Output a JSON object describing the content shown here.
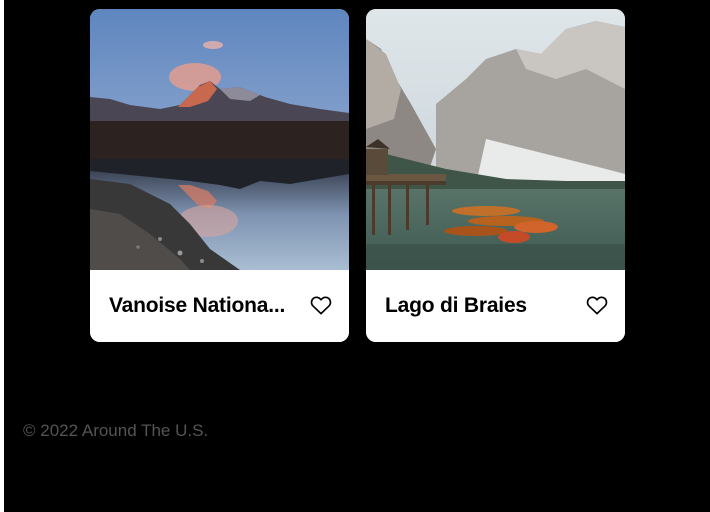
{
  "cards": [
    {
      "title": "Vanoise Nationa...",
      "like_icon": "heart-outline-icon",
      "image": "mountain-lake-dusk"
    },
    {
      "title": "Lago di Braies",
      "like_icon": "heart-outline-icon",
      "image": "lake-boats-mountains"
    }
  ],
  "footer": {
    "copyright": "© 2022 Around The U.S."
  },
  "colors": {
    "background": "#000000",
    "card": "#ffffff",
    "footer_text": "#545454"
  }
}
